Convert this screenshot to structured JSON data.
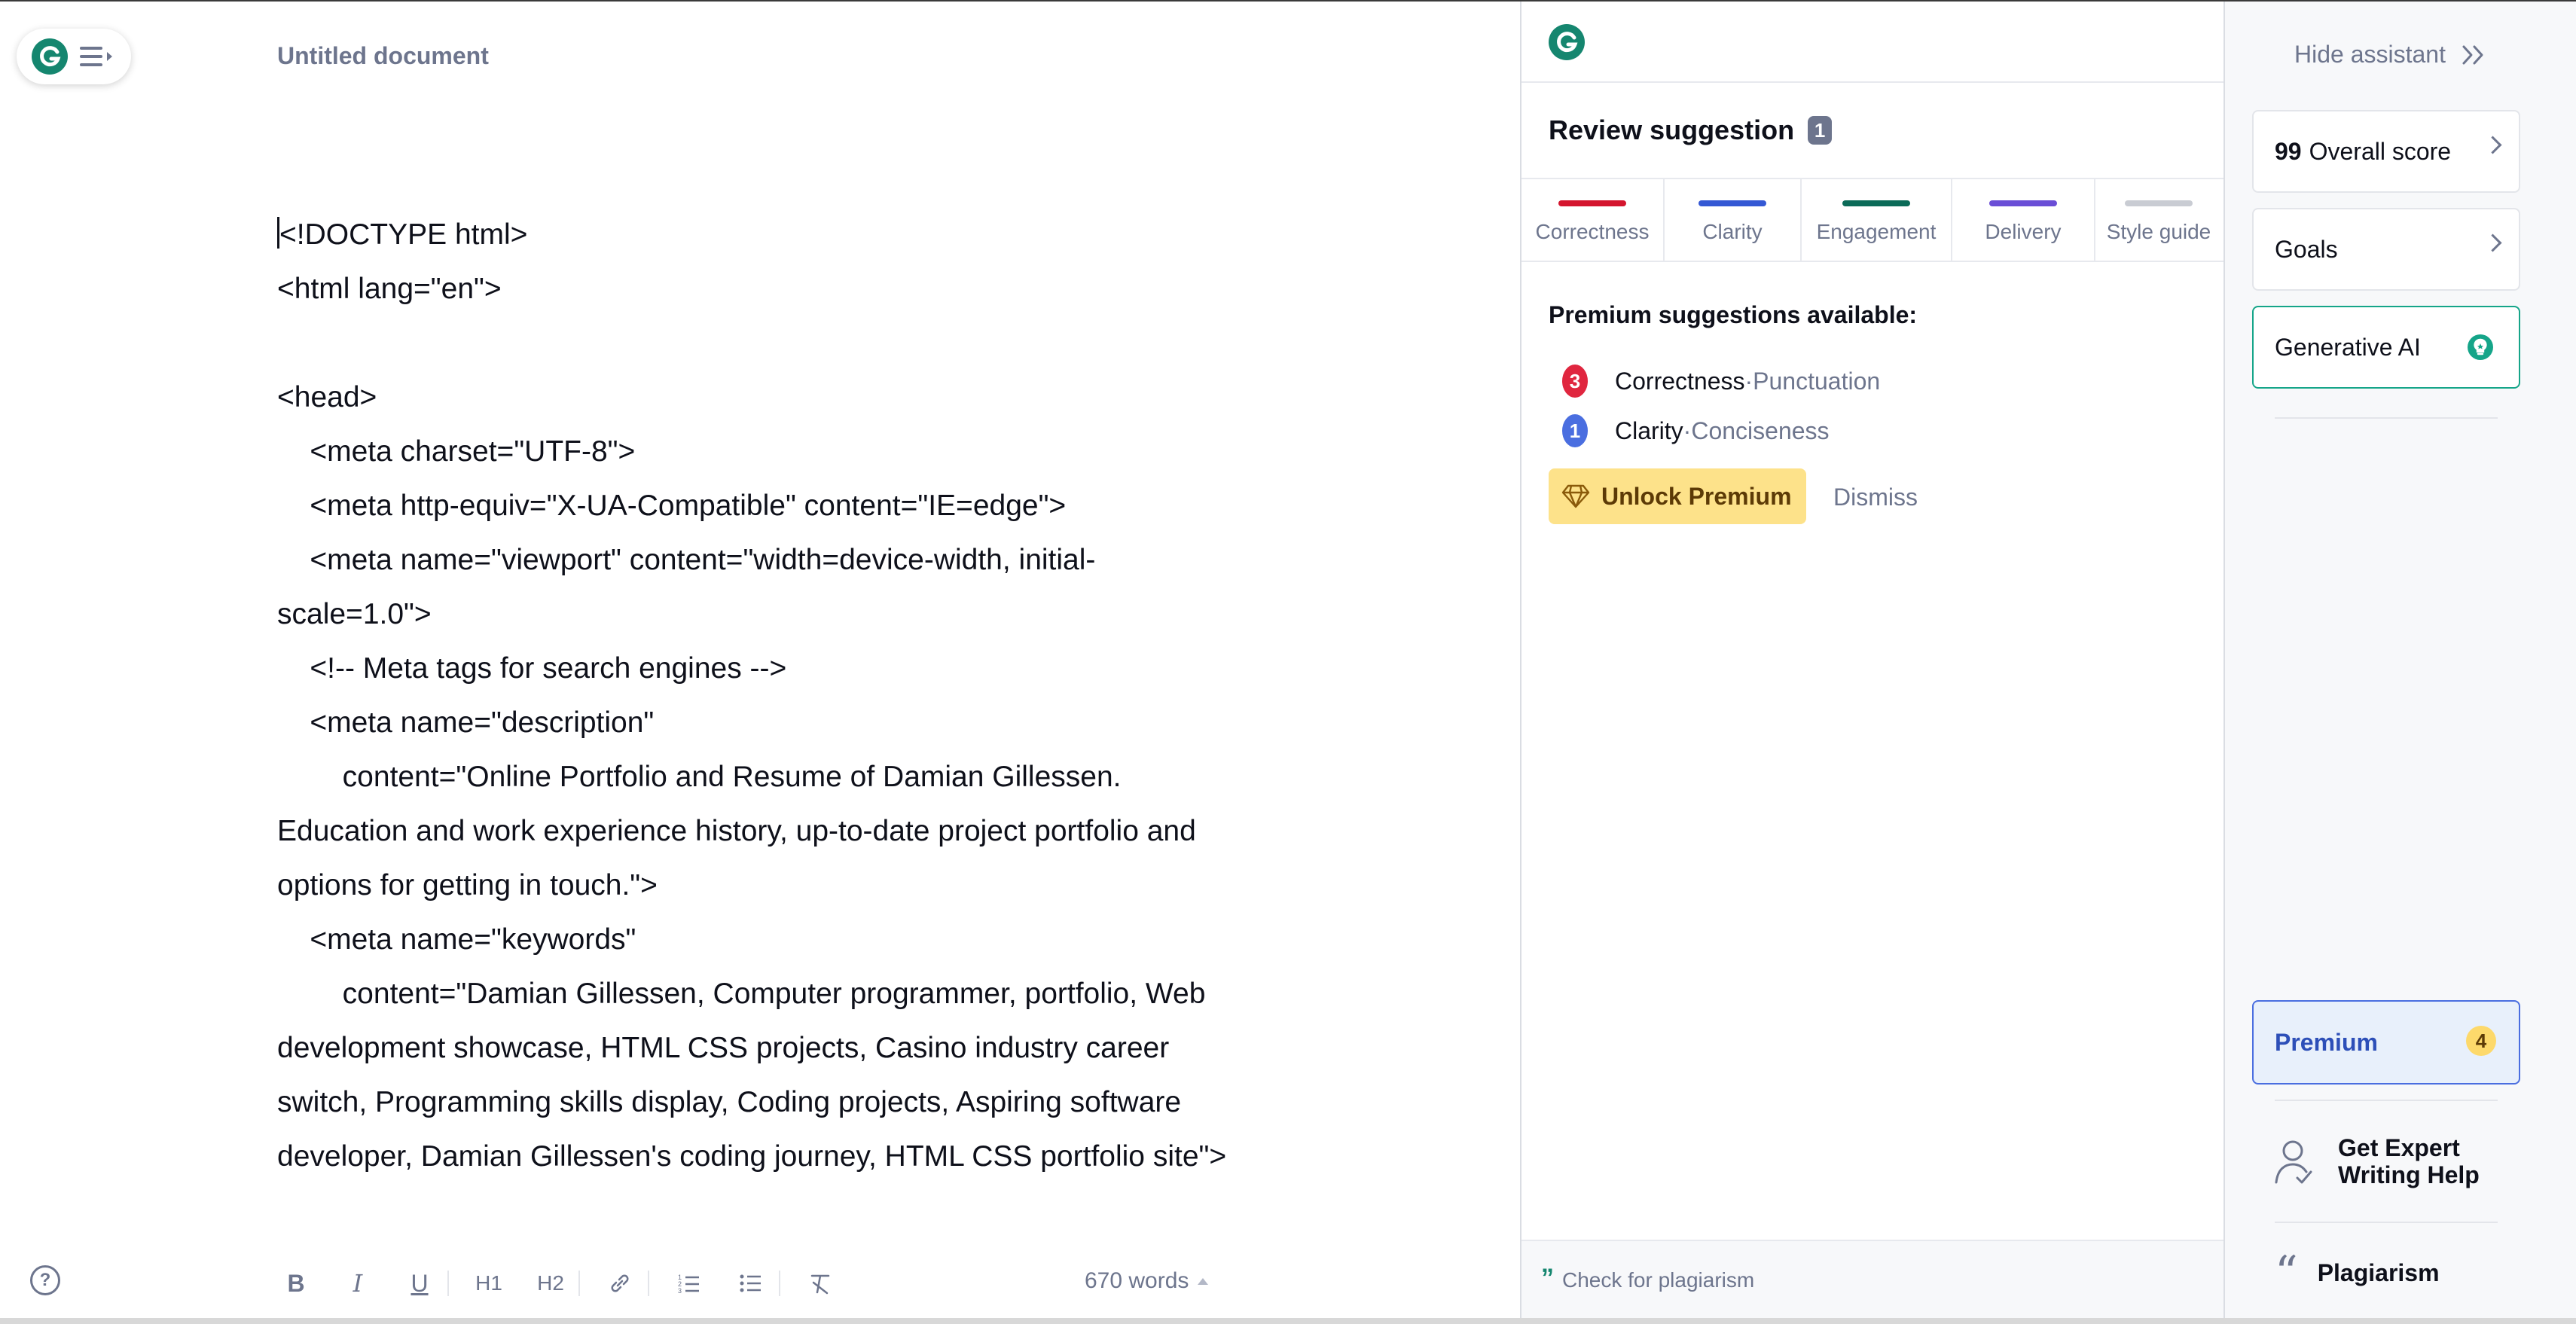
{
  "editor": {
    "doc_title": "Untitled document",
    "lines": [
      "<!DOCTYPE html>",
      "<html lang=\"en\">",
      "",
      "<head>",
      "    <meta charset=\"UTF-8\">",
      "    <meta http-equiv=\"X-UA-Compatible\" content=\"IE=edge\">",
      "    <meta name=\"viewport\" content=\"width=device-width, initial-",
      "scale=1.0\">",
      "    <!-- Meta tags for search engines -->",
      "    <meta name=\"description\"",
      "        content=\"Online Portfolio and Resume of Damian Gillessen.",
      "Education and work experience history, up-to-date project portfolio and",
      "options for getting in touch.\">",
      "    <meta name=\"keywords\"",
      "        content=\"Damian Gillessen, Computer programmer, portfolio, Web",
      "development showcase, HTML CSS projects, Casino industry career",
      "switch, Programming skills display, Coding projects, Aspiring software",
      "developer, Damian Gillessen's coding journey, HTML CSS portfolio site\">"
    ],
    "word_count": "670 words",
    "toolbar": {
      "bold": "B",
      "italic": "I",
      "underline": "U",
      "h1": "H1",
      "h2": "H2"
    },
    "help": "?"
  },
  "assistant": {
    "review_title": "Review suggestion",
    "review_count": "1",
    "tabs": [
      {
        "label": "Correctness",
        "color": "#d4152e"
      },
      {
        "label": "Clarity",
        "color": "#3458d4"
      },
      {
        "label": "Engagement",
        "color": "#0b6b58"
      },
      {
        "label": "Delivery",
        "color": "#6a4ed6"
      },
      {
        "label": "Style guide",
        "color": "#c9ccd3"
      }
    ],
    "premium_title": "Premium suggestions available:",
    "suggestions": [
      {
        "count": "3",
        "category": "Correctness",
        "subcategory": "Punctuation",
        "color": "#e0263f"
      },
      {
        "count": "1",
        "category": "Clarity",
        "subcategory": "Conciseness",
        "color": "#4a6ee0"
      }
    ],
    "separator": " · ",
    "unlock_label": "Unlock Premium",
    "dismiss_label": "Dismiss",
    "plagiarism_check": "Check for plagiarism"
  },
  "sidebar": {
    "hide_label": "Hide assistant",
    "score_value": "99",
    "score_label": "Overall score",
    "goals_label": "Goals",
    "genai_label": "Generative AI",
    "premium_label": "Premium",
    "premium_count": "4",
    "expert_label_1": "Get Expert",
    "expert_label_2": "Writing Help",
    "plagiarism_label": "Plagiarism"
  },
  "colors": {
    "brand": "#15866f",
    "premium_yellow": "#fde28a"
  }
}
